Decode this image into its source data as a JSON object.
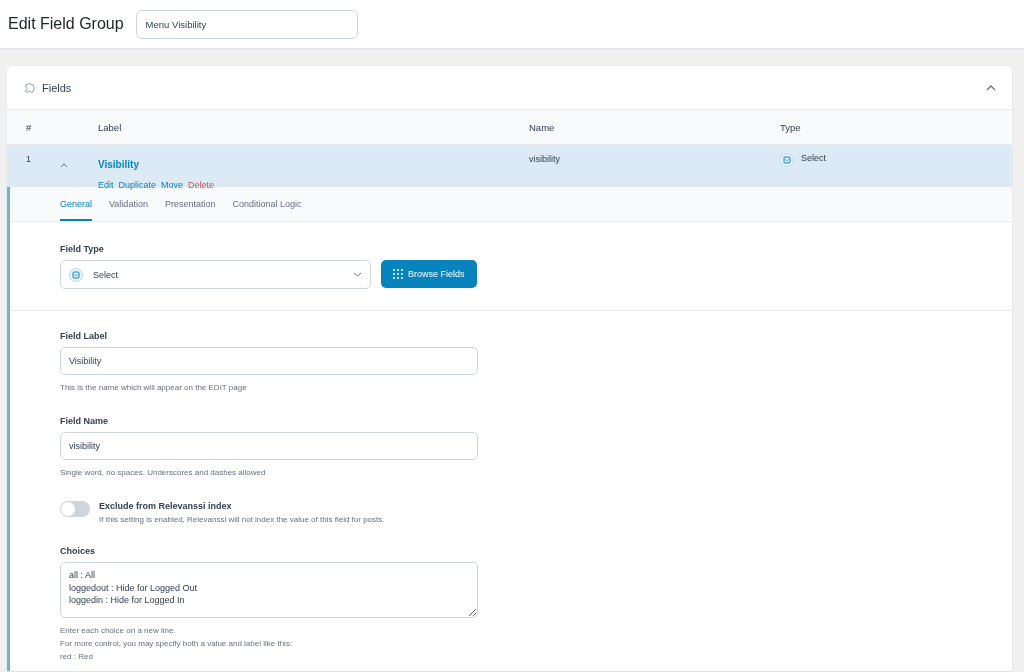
{
  "header": {
    "title": "Edit Field Group",
    "group_title": "Menu Visibility"
  },
  "panel": {
    "title": "Fields",
    "expanded": true,
    "columns": [
      "#",
      "Label",
      "Name",
      "Type"
    ],
    "field": {
      "order": "1",
      "expanded": true,
      "label": "Visibility",
      "actions": [
        {
          "label": "Edit",
          "kind": "normal"
        },
        {
          "label": "Duplicate",
          "kind": "normal"
        },
        {
          "label": "Move",
          "kind": "normal"
        },
        {
          "label": "Delete",
          "kind": "danger"
        }
      ],
      "name": "visibility",
      "type": "Select",
      "tabs": [
        {
          "label": "General",
          "selected": true
        },
        {
          "label": "Validation",
          "selected": false
        },
        {
          "label": "Presentation",
          "selected": false
        },
        {
          "label": "Conditional Logic",
          "selected": false
        }
      ],
      "field_type": {
        "label": "Field Type",
        "value": "Select",
        "browse_button": "Browse Fields"
      },
      "field_label": {
        "label": "Field Label",
        "value": "Visibility",
        "help": "This is the name which will appear on the EDIT page"
      },
      "field_name": {
        "label": "Field Name",
        "value": "visibility",
        "help": "Single word, no spaces. Underscores and dashes allowed"
      },
      "relevanssi": {
        "label": "Exclude from Relevanssi index",
        "help": "If this setting is enabled, Relevanssi will not index the value of this field for posts.",
        "on": false
      },
      "choices": {
        "label": "Choices",
        "value": "all : All\nloggedout : Hide for Logged Out\nloggedin : Hide for Logged In",
        "help": [
          "Enter each choice on a new line.",
          "For more control, you may specify both a value and label like this:",
          "red : Red"
        ]
      }
    }
  }
}
